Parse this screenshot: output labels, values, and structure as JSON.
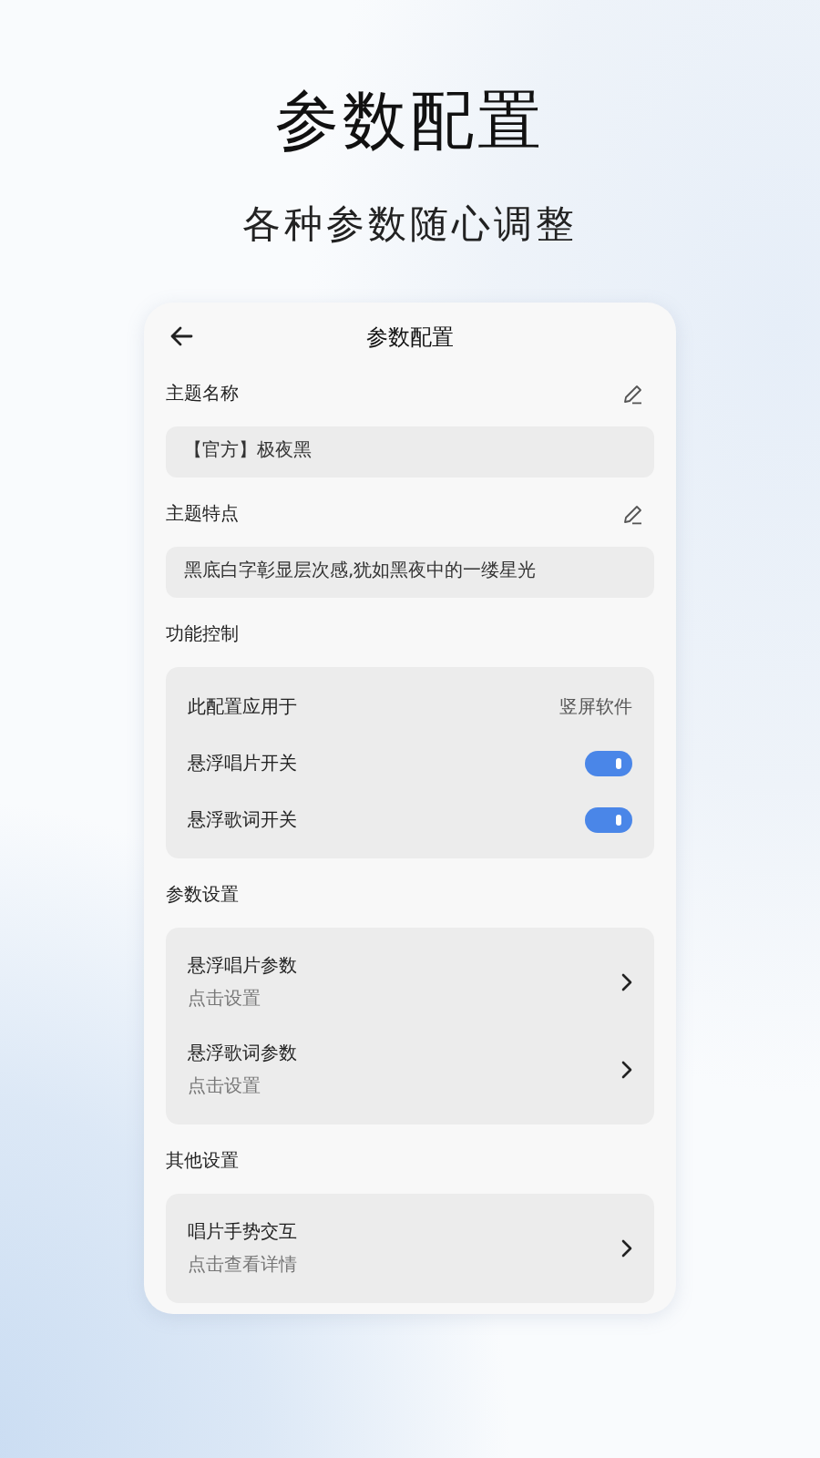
{
  "promo": {
    "title": "参数配置",
    "subtitle": "各种参数随心调整"
  },
  "screen": {
    "title": "参数配置",
    "theme_fields": [
      {
        "label": "主题名称",
        "value": "【官方】极夜黑"
      },
      {
        "label": "主题特点",
        "value": "黑底白字彰显层次感,犹如黑夜中的一缕星光"
      }
    ],
    "groups": [
      {
        "heading": "功能控制",
        "rows": [
          {
            "kind": "value",
            "label": "此配置应用于",
            "value": "竖屏软件"
          },
          {
            "kind": "toggle",
            "label": "悬浮唱片开关",
            "on": true
          },
          {
            "kind": "toggle",
            "label": "悬浮歌词开关",
            "on": true
          }
        ]
      },
      {
        "heading": "参数设置",
        "rows": [
          {
            "kind": "link",
            "label": "悬浮唱片参数",
            "hint": "点击设置"
          },
          {
            "kind": "link",
            "label": "悬浮歌词参数",
            "hint": "点击设置"
          }
        ]
      },
      {
        "heading": "其他设置",
        "rows": [
          {
            "kind": "link",
            "label": "唱片手势交互",
            "hint": "点击查看详情"
          }
        ]
      }
    ]
  }
}
